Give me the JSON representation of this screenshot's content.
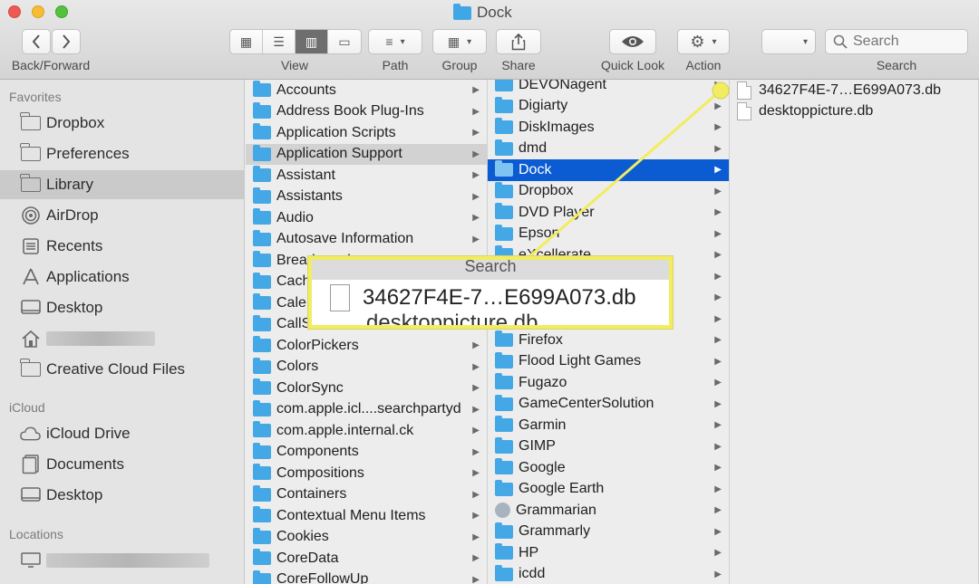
{
  "window": {
    "title": "Dock"
  },
  "toolbar": {
    "back_forward_label": "Back/Forward",
    "view_label": "View",
    "path_label": "Path",
    "group_label": "Group",
    "share_label": "Share",
    "quicklook_label": "Quick Look",
    "action_label": "Action",
    "search_label": "Search",
    "search_placeholder": "Search"
  },
  "sidebar": {
    "favorites_header": "Favorites",
    "favorites": [
      {
        "label": "Dropbox",
        "icon": "folder-icon"
      },
      {
        "label": "Preferences",
        "icon": "folder-icon"
      },
      {
        "label": "Library",
        "icon": "folder-icon",
        "selected": true
      },
      {
        "label": "AirDrop",
        "icon": "airdrop-icon"
      },
      {
        "label": "Recents",
        "icon": "recents-icon"
      },
      {
        "label": "Applications",
        "icon": "applications-icon"
      },
      {
        "label": "Desktop",
        "icon": "desktop-icon"
      },
      {
        "label": "",
        "icon": "home-icon"
      },
      {
        "label": "Creative Cloud Files",
        "icon": "folder-icon"
      }
    ],
    "icloud_header": "iCloud",
    "icloud": [
      {
        "label": "iCloud Drive",
        "icon": "cloud-icon"
      },
      {
        "label": "Documents",
        "icon": "documents-icon"
      },
      {
        "label": "Desktop",
        "icon": "desktop-icon"
      }
    ],
    "locations_header": "Locations"
  },
  "column1": [
    "Accounts",
    "Address Book Plug-Ins",
    "Application Scripts",
    "Application Support",
    "Assistant",
    "Assistants",
    "Audio",
    "Autosave Information",
    "Breadcrumbs",
    "Caches",
    "Calendars",
    "CallServices",
    "ColorPickers",
    "Colors",
    "ColorSync",
    "com.apple.icl....searchpartyd",
    "com.apple.internal.ck",
    "Components",
    "Compositions",
    "Containers",
    "Contextual Menu Items",
    "Cookies",
    "CoreData",
    "CoreFollowUp"
  ],
  "column2": [
    "DEVONagent",
    "Digiarty",
    "DiskImages",
    "dmd",
    "Dock",
    "Dropbox",
    "DVD Player",
    "Epson",
    "eXcellerate",
    "",
    "",
    "",
    "Firefox",
    "Flood Light Games",
    "Fugazo",
    "GameCenterSolution",
    "Garmin",
    "GIMP",
    "Google",
    "Google Earth",
    "Grammarian",
    "Grammarly",
    "HP",
    "icdd"
  ],
  "column3": [
    "34627F4E-7…E699A073.db",
    "desktoppicture.db"
  ],
  "callout": {
    "header": "Search",
    "file": "34627F4E-7…E699A073.db",
    "cut_file": "desktoppicture.db"
  },
  "colors": {
    "selection": "#0b5bd2",
    "folder": "#44a8e6",
    "callout_border": "#f2ec5f"
  }
}
